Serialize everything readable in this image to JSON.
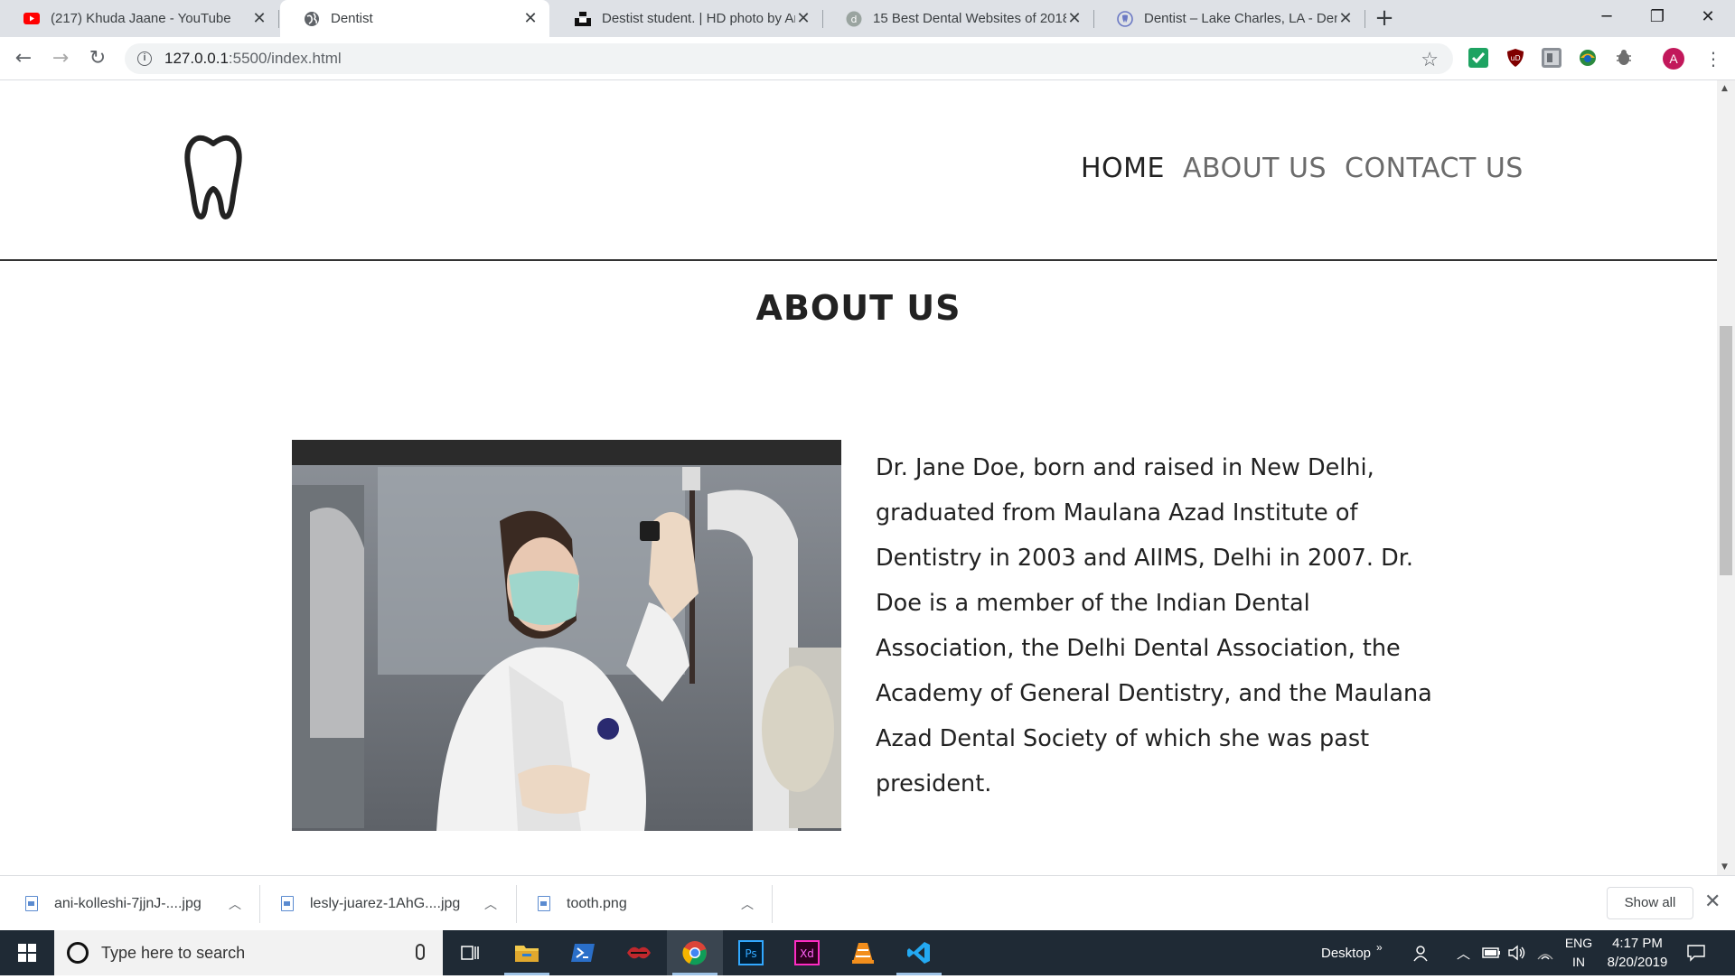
{
  "browser": {
    "tabs": [
      {
        "title": "(217) Khuda Jaane - YouTube",
        "icon": "youtube-icon",
        "active": false
      },
      {
        "title": "Dentist",
        "icon": "globe-icon",
        "active": true
      },
      {
        "title": "Destist student. | HD photo by Ar",
        "icon": "unsplash-icon",
        "active": false
      },
      {
        "title": "15 Best Dental Websites of 2018",
        "icon": "site-icon",
        "active": false
      },
      {
        "title": "Dentist – Lake Charles, LA - Dent",
        "icon": "dental-icon",
        "active": false
      }
    ],
    "address": {
      "host": "127.0.0.1",
      "path": ":5500/index.html"
    }
  },
  "site": {
    "nav": {
      "home": "HOME",
      "about": "ABOUT US",
      "contact": "CONTACT US"
    },
    "about": {
      "title": "ABOUT US",
      "bio": "Dr. Jane Doe, born and raised in New Delhi, graduated from Maulana Azad Institute of Dentistry in 2003 and AIIMS, Delhi in 2007. Dr. Doe is a member of the Indian Dental Association, the Delhi Dental Association, the Academy of General Dentistry, and the Maulana Azad Dental Society of which she was past president."
    }
  },
  "downloads": {
    "files": [
      "ani-kolleshi-7jjnJ-....jpg",
      "lesly-juarez-1AhG....jpg",
      "tooth.png"
    ],
    "show_all": "Show all"
  },
  "taskbar": {
    "search_placeholder": "Type here to search",
    "desktop_label": "Desktop",
    "lang_top": "ENG",
    "lang_bottom": "IN",
    "time": "4:17 PM",
    "date": "8/20/2019"
  },
  "colors": {
    "accent": "#c2185b",
    "taskbar": "#1f2a35",
    "nav_active": "#222222",
    "nav_inactive": "#6b6b6b"
  }
}
